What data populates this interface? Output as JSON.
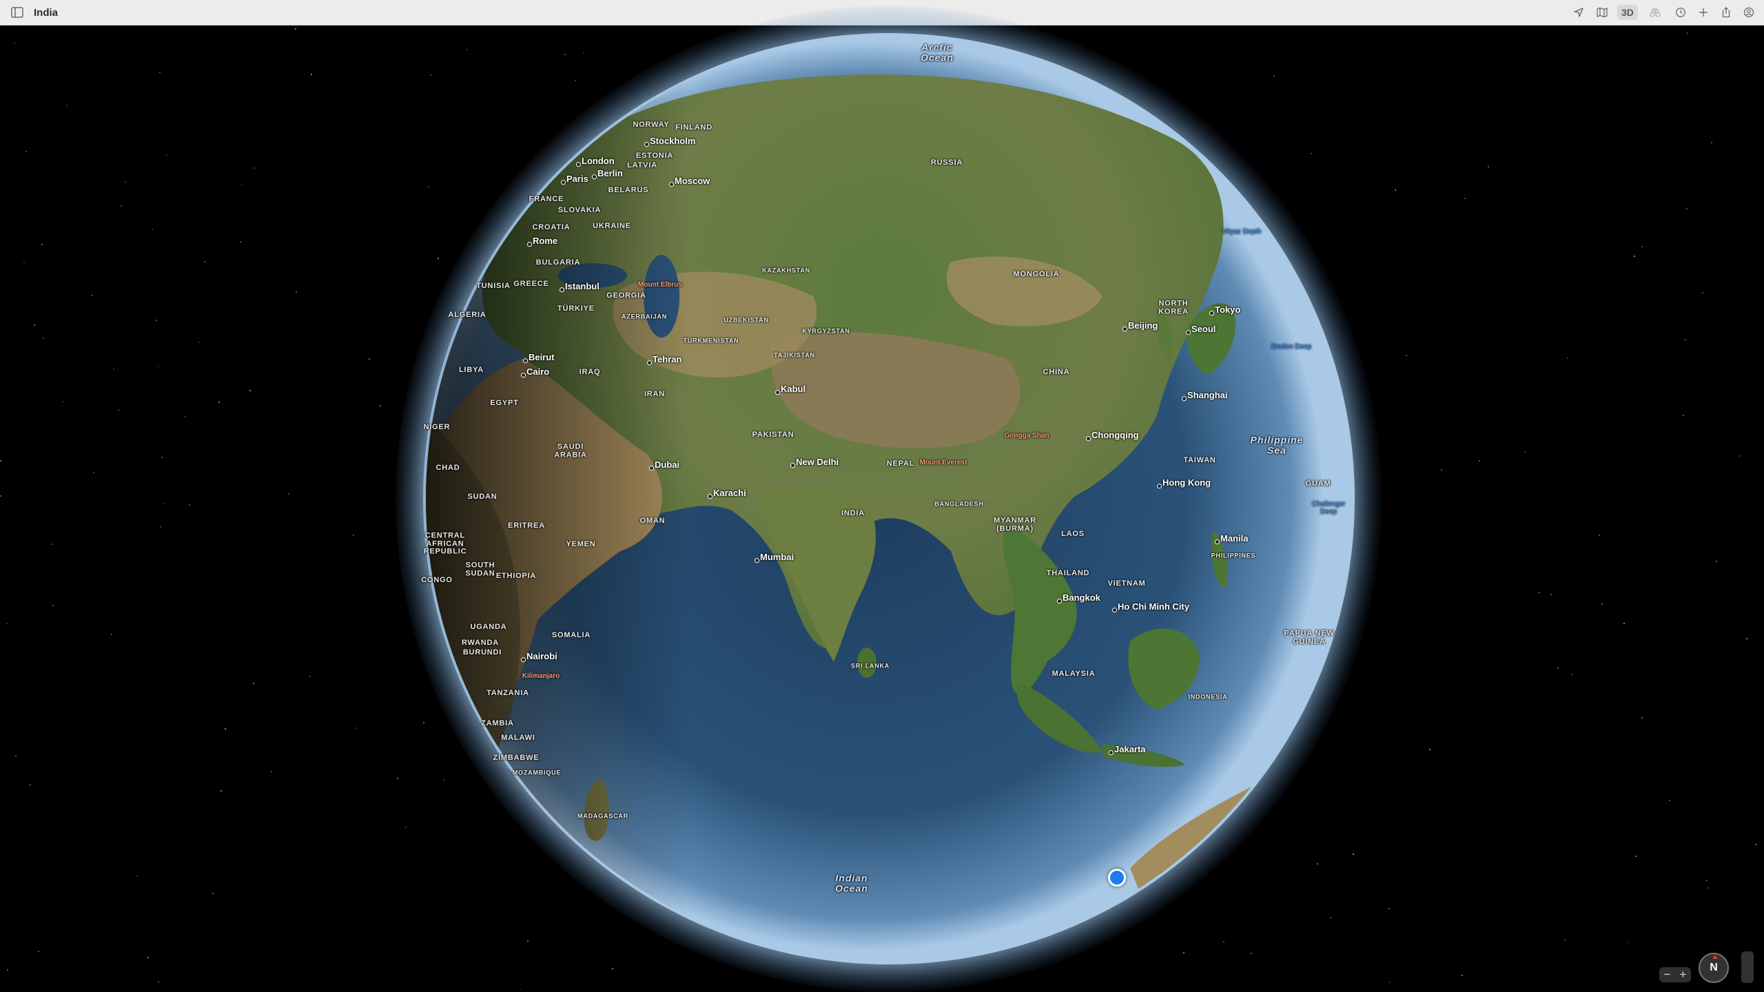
{
  "window": {
    "title": "India"
  },
  "toolbar": {
    "icons": [
      "sidebar-icon",
      "location-arrow-icon",
      "map-icon",
      "look-around-icon",
      "binoculars-icon",
      "recents-icon",
      "plus-icon",
      "share-icon",
      "account-icon"
    ],
    "mode_3d_label": "3D"
  },
  "map": {
    "oceans": [
      {
        "id": "arctic",
        "text": "Arctic\nOcean"
      },
      {
        "id": "indian",
        "text": "Indian\nOcean"
      },
      {
        "id": "philippine",
        "text": "Philippine\nSea"
      }
    ],
    "countries": [
      {
        "text": "NORWAY"
      },
      {
        "text": "FINLAND"
      },
      {
        "text": "ESTONIA"
      },
      {
        "text": "LATVIA"
      },
      {
        "text": "BELARUS"
      },
      {
        "text": "FRANCE"
      },
      {
        "text": "SLOVAKIA"
      },
      {
        "text": "CROATIA"
      },
      {
        "text": "UKRAINE"
      },
      {
        "text": "BULGARIA"
      },
      {
        "text": "TUNISIA"
      },
      {
        "text": "GREECE"
      },
      {
        "text": "GEORGIA"
      },
      {
        "text": "TÜRKIYE"
      },
      {
        "text": "AZERBAIJAN"
      },
      {
        "text": "ALGERIA"
      },
      {
        "text": "LIBYA"
      },
      {
        "text": "EGYPT"
      },
      {
        "text": "NIGER"
      },
      {
        "text": "CHAD"
      },
      {
        "text": "SUDAN"
      },
      {
        "text": "ERITREA"
      },
      {
        "text": "CENTRAL\nAFRICAN\nREPUBLIC"
      },
      {
        "text": "SOUTH\nSUDAN"
      },
      {
        "text": "ETHIOPIA"
      },
      {
        "text": "CONGO"
      },
      {
        "text": "UGANDA"
      },
      {
        "text": "RWANDA"
      },
      {
        "text": "BURUNDI"
      },
      {
        "text": "SOMALIA"
      },
      {
        "text": "TANZANIA"
      },
      {
        "text": "ZAMBIA"
      },
      {
        "text": "MALAWI"
      },
      {
        "text": "ZIMBABWE"
      },
      {
        "text": "MOZAMBIQUE"
      },
      {
        "text": "MADAGASCAR"
      },
      {
        "text": "RUSSIA"
      },
      {
        "text": "KAZAKHSTAN"
      },
      {
        "text": "UZBEKISTAN"
      },
      {
        "text": "TURKMENISTAN"
      },
      {
        "text": "KYRGYZSTAN"
      },
      {
        "text": "TAJIKISTAN"
      },
      {
        "text": "IRAQ"
      },
      {
        "text": "IRAN"
      },
      {
        "text": "SAUDI\nARABIA"
      },
      {
        "text": "OMAN"
      },
      {
        "text": "YEMEN"
      },
      {
        "text": "PAKISTAN"
      },
      {
        "text": "NEPAL"
      },
      {
        "text": "INDIA"
      },
      {
        "text": "BANGLADESH"
      },
      {
        "text": "SRI LANKA"
      },
      {
        "text": "MONGOLIA"
      },
      {
        "text": "CHINA"
      },
      {
        "text": "NORTH\nKOREA"
      },
      {
        "text": "TAIWAN"
      },
      {
        "text": "MYANMAR\n(BURMA)"
      },
      {
        "text": "LAOS"
      },
      {
        "text": "THAILAND"
      },
      {
        "text": "VIETNAM"
      },
      {
        "text": "MALAYSIA"
      },
      {
        "text": "PHILIPPINES"
      },
      {
        "text": "INDONESIA"
      },
      {
        "text": "PAPUA NEW\nGUINEA"
      },
      {
        "text": "GUAM"
      }
    ],
    "cities": [
      {
        "text": "Stockholm"
      },
      {
        "text": "London"
      },
      {
        "text": "Paris"
      },
      {
        "text": "Berlin"
      },
      {
        "text": "Moscow"
      },
      {
        "text": "Rome"
      },
      {
        "text": "Istanbul"
      },
      {
        "text": "Beirut"
      },
      {
        "text": "Cairo"
      },
      {
        "text": "Tehran"
      },
      {
        "text": "Kabul"
      },
      {
        "text": "Dubai"
      },
      {
        "text": "Karachi"
      },
      {
        "text": "New Delhi"
      },
      {
        "text": "Mumbai"
      },
      {
        "text": "Nairobi"
      },
      {
        "text": "Beijing"
      },
      {
        "text": "Seoul"
      },
      {
        "text": "Tokyo"
      },
      {
        "text": "Shanghai"
      },
      {
        "text": "Chongqing"
      },
      {
        "text": "Hong Kong"
      },
      {
        "text": "Manila"
      },
      {
        "text": "Bangkok"
      },
      {
        "text": "Ho Chi Minh City"
      },
      {
        "text": "Jakarta"
      }
    ],
    "landmarks": [
      {
        "text": "Mount Elbrus"
      },
      {
        "text": "Mount Everest"
      },
      {
        "text": "Gongga Shan"
      },
      {
        "text": "Kilimanjaro"
      }
    ],
    "trenches": [
      {
        "text": "Vityaz Depth"
      },
      {
        "text": "Challenger\nDeep"
      },
      {
        "text": "Emden Deep"
      }
    ]
  },
  "controls": {
    "zoom_out": "−",
    "zoom_in": "+",
    "compass": "N"
  },
  "colors": {
    "titlebar": "#ececec",
    "space": "#000000",
    "location": "#1e7bf0"
  }
}
